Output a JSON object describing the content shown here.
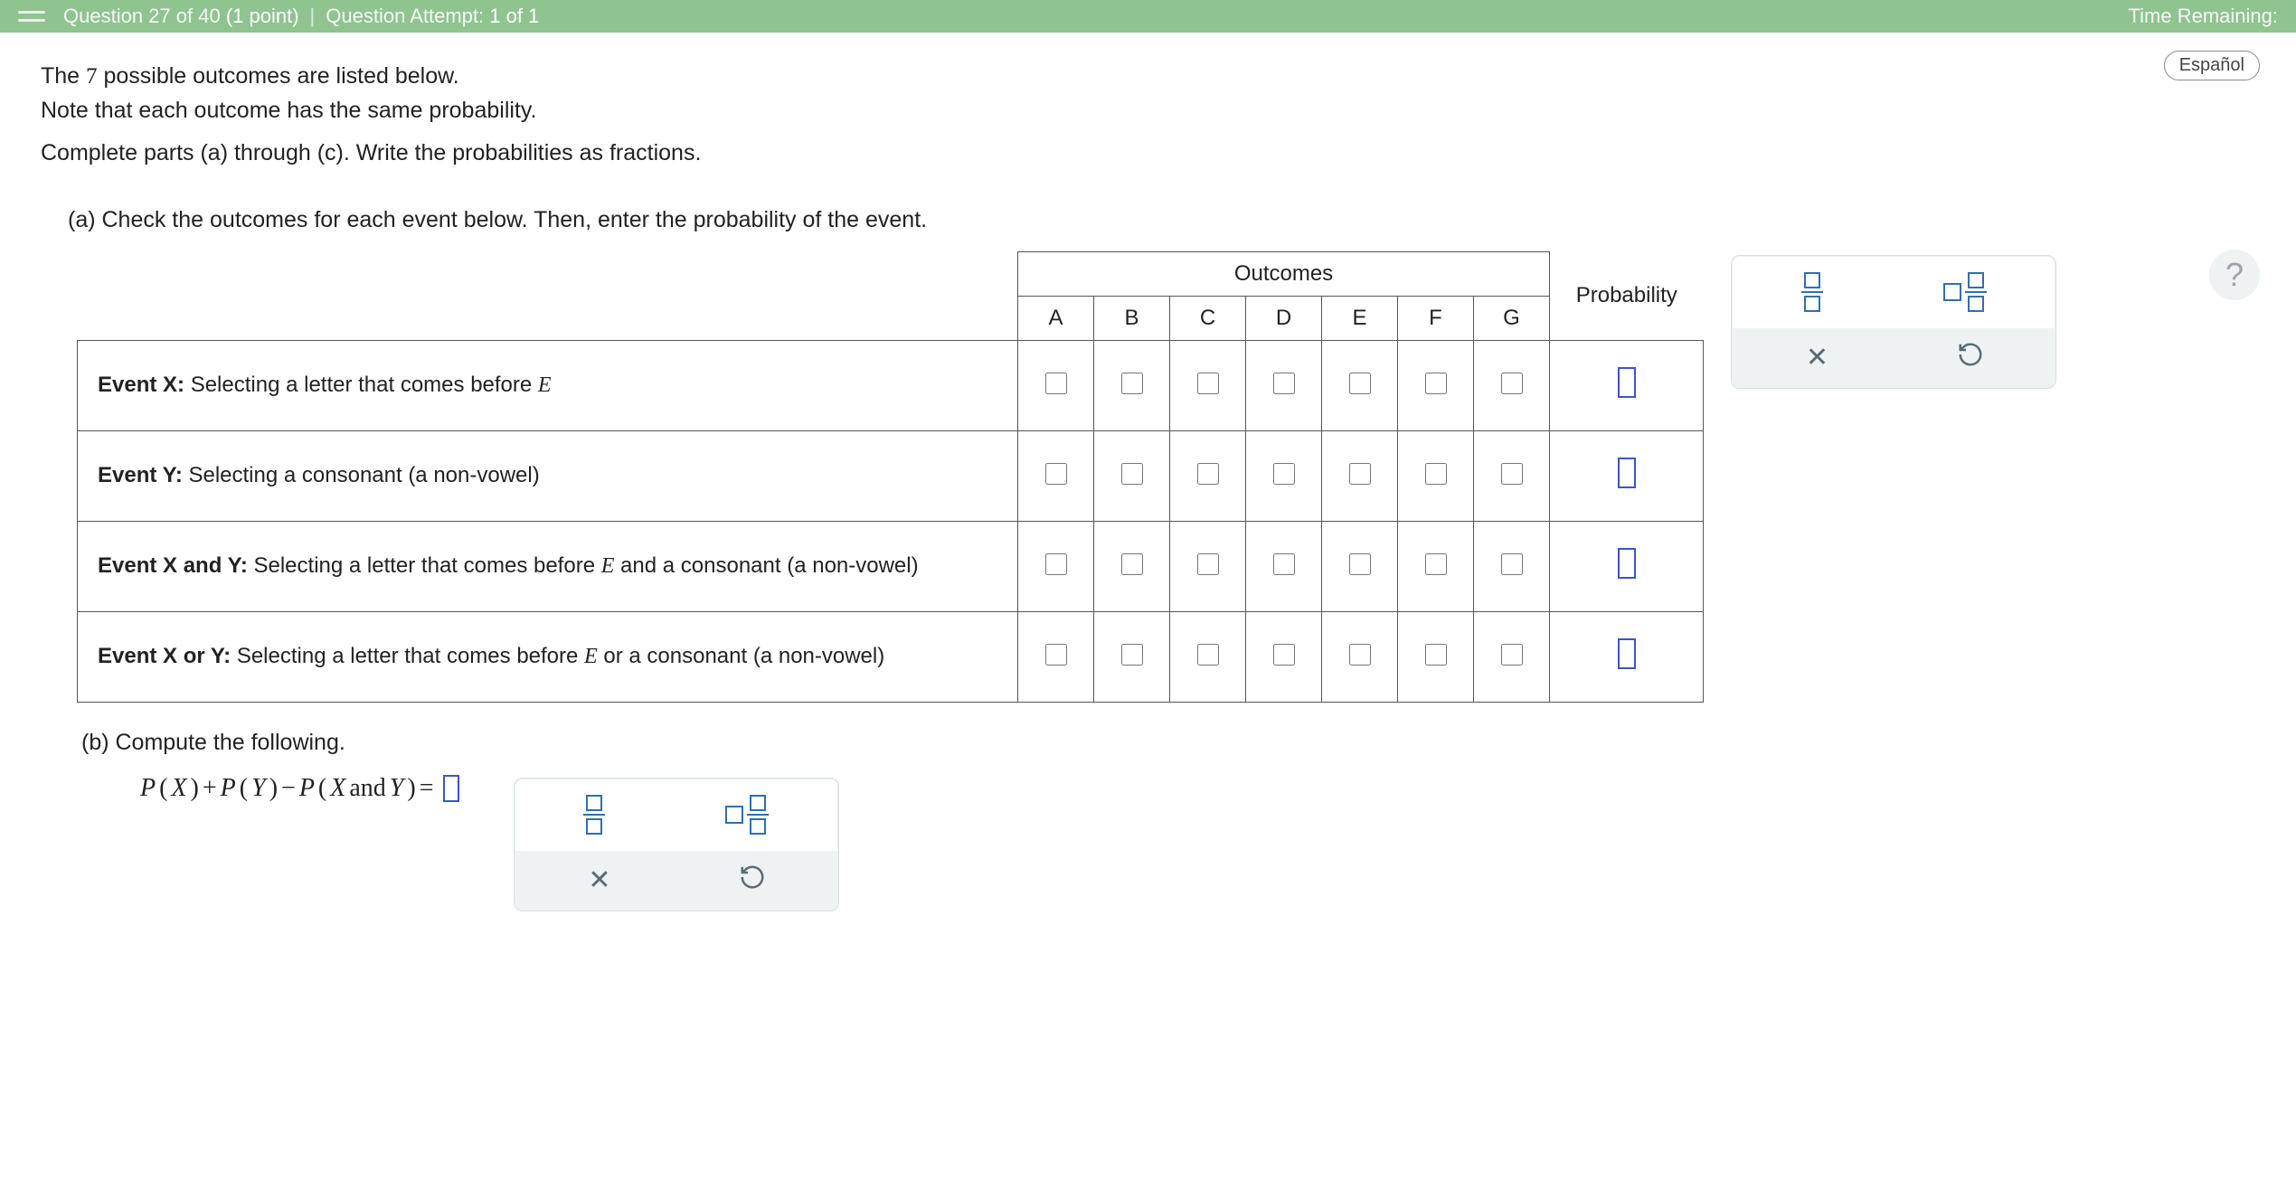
{
  "topbar": {
    "question_of": "Question 27 of 40",
    "points": "(1 point)",
    "attempt_label": "Question Attempt:",
    "attempt_value": "1 of 1",
    "time_label": "Time Remaining:"
  },
  "espanol": "Español",
  "instructions": {
    "line1_a": "The ",
    "line1_num": "7",
    "line1_b": " possible outcomes are listed below.",
    "line2": "Note that each outcome has the same probability.",
    "line3": "Complete parts (a) through (c). Write the probabilities as fractions."
  },
  "part_a": "(a) Check the outcomes for each event below. Then, enter the probability of the event.",
  "table": {
    "outcomes_header": "Outcomes",
    "prob_header": "Probability",
    "cols": [
      "A",
      "B",
      "C",
      "D",
      "E",
      "F",
      "G"
    ],
    "events": [
      {
        "bold": "Event X:",
        "rest_a": " Selecting a letter that comes before ",
        "ital": "E",
        "rest_b": ""
      },
      {
        "bold": "Event Y:",
        "rest_a": " Selecting a consonant (a non-vowel)",
        "ital": "",
        "rest_b": ""
      },
      {
        "bold": "Event X and Y:",
        "rest_a": " Selecting a letter that comes before ",
        "ital": "E",
        "rest_b": " and a consonant (a non-vowel)"
      },
      {
        "bold": "Event X or Y:",
        "rest_a": " Selecting a letter that comes before ",
        "ital": "E",
        "rest_b": " or a consonant (a non-vowel)"
      }
    ]
  },
  "part_b": "(b) Compute the following.",
  "equation": {
    "p1": "P",
    "op": "(",
    "x": "X",
    "cp": ")",
    "plus": " + ",
    "y": "Y",
    "minus": " − ",
    "and": " and ",
    "eq": " = "
  },
  "tools": {
    "clear_title": "clear",
    "undo_title": "undo"
  }
}
